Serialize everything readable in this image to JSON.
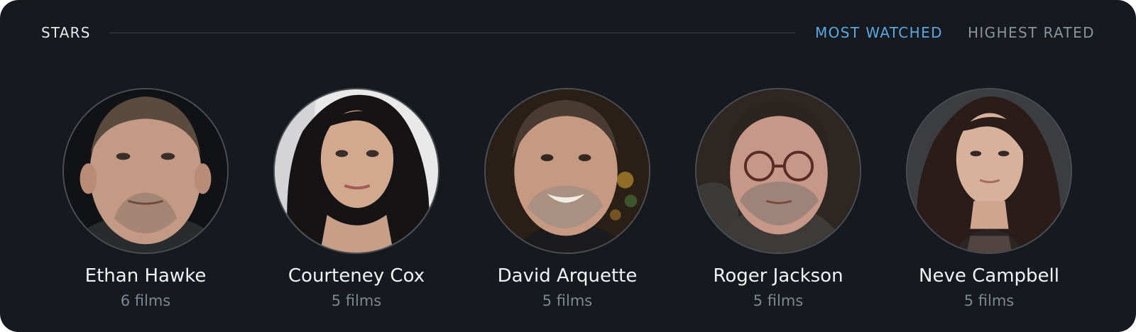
{
  "section": {
    "title": "STARS"
  },
  "tabs": [
    {
      "label": "MOST WATCHED",
      "active": true
    },
    {
      "label": "HIGHEST RATED",
      "active": false
    }
  ],
  "stars": [
    {
      "name": "Ethan Hawke",
      "count": "6 films"
    },
    {
      "name": "Courteney Cox",
      "count": "5 films"
    },
    {
      "name": "David Arquette",
      "count": "5 films"
    },
    {
      "name": "Roger Jackson",
      "count": "5 films"
    },
    {
      "name": "Neve Campbell",
      "count": "5 films"
    }
  ],
  "colors": {
    "accent": "#5aa9e6",
    "background": "#16191d"
  }
}
